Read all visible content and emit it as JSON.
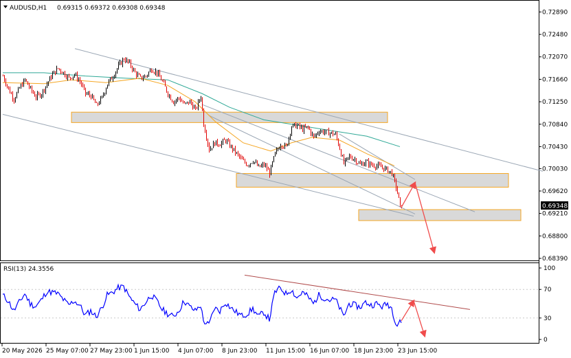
{
  "header": {
    "dropdown_icon": "triangle-down-icon",
    "symbol": "AUDUSD,H1",
    "ohlc": "0.69315 0.69372 0.69308 0.69348"
  },
  "rsi_header": {
    "label": "RSI(13) 24.3556"
  },
  "chart_data": [
    {
      "type": "candlestick",
      "symbol": "AUDUSD",
      "timeframe": "H1",
      "ylim": [
        0.6839,
        0.7292
      ],
      "y_ticks": [
        "0.72890",
        "0.72480",
        "0.72070",
        "0.71660",
        "0.71250",
        "0.70840",
        "0.70430",
        "0.70030",
        "0.69620",
        "0.69210",
        "0.68800",
        "0.68390"
      ],
      "current_price": "0.69348",
      "grid": false,
      "colors": {
        "up": "#000000",
        "down": "#e00000",
        "ma_fast": "#f5a623",
        "ma_slow": "#2ea896",
        "channel": "#9aa6b4",
        "zone": "#d9d9d9",
        "zone_border": "#f5a623",
        "arrow": "#f04c4c"
      },
      "price_path": [
        [
          0,
          0.7172
        ],
        [
          8,
          0.7148
        ],
        [
          16,
          0.713
        ],
        [
          24,
          0.715
        ],
        [
          32,
          0.7165
        ],
        [
          40,
          0.7148
        ],
        [
          48,
          0.7134
        ],
        [
          56,
          0.714
        ],
        [
          64,
          0.7158
        ],
        [
          72,
          0.7175
        ],
        [
          80,
          0.7186
        ],
        [
          88,
          0.7178
        ],
        [
          96,
          0.7168
        ],
        [
          104,
          0.7175
        ],
        [
          112,
          0.7162
        ],
        [
          120,
          0.714
        ],
        [
          128,
          0.7136
        ],
        [
          136,
          0.7118
        ],
        [
          144,
          0.7132
        ],
        [
          152,
          0.7158
        ],
        [
          160,
          0.7172
        ],
        [
          168,
          0.719
        ],
        [
          176,
          0.7204
        ],
        [
          184,
          0.7195
        ],
        [
          192,
          0.7178
        ],
        [
          200,
          0.7168
        ],
        [
          208,
          0.7172
        ],
        [
          216,
          0.7185
        ],
        [
          224,
          0.7178
        ],
        [
          232,
          0.7162
        ],
        [
          240,
          0.714
        ],
        [
          248,
          0.7125
        ],
        [
          256,
          0.7132
        ],
        [
          264,
          0.712
        ],
        [
          272,
          0.7125
        ],
        [
          280,
          0.711
        ],
        [
          288,
          0.7135
        ],
        [
          292,
          0.7085
        ],
        [
          300,
          0.7038
        ],
        [
          308,
          0.705
        ],
        [
          316,
          0.7048
        ],
        [
          324,
          0.7055
        ],
        [
          332,
          0.7042
        ],
        [
          340,
          0.703
        ],
        [
          348,
          0.7018
        ],
        [
          356,
          0.701
        ],
        [
          364,
          0.7018
        ],
        [
          372,
          0.7005
        ],
        [
          380,
          0.701
        ],
        [
          388,
          0.6995
        ],
        [
          396,
          0.703
        ],
        [
          404,
          0.7048
        ],
        [
          412,
          0.7042
        ],
        [
          420,
          0.708
        ],
        [
          428,
          0.7082
        ],
        [
          436,
          0.7075
        ],
        [
          444,
          0.7078
        ],
        [
          452,
          0.706
        ],
        [
          460,
          0.7072
        ],
        [
          468,
          0.707
        ],
        [
          476,
          0.7068
        ],
        [
          484,
          0.7065
        ],
        [
          490,
          0.704
        ],
        [
          496,
          0.7012
        ],
        [
          504,
          0.7025
        ],
        [
          512,
          0.702
        ],
        [
          520,
          0.701
        ],
        [
          528,
          0.7015
        ],
        [
          536,
          0.701
        ],
        [
          544,
          0.7008
        ],
        [
          552,
          0.7005
        ],
        [
          560,
          0.7
        ],
        [
          566,
          0.6995
        ],
        [
          570,
          0.6978
        ],
        [
          574,
          0.696
        ],
        [
          578,
          0.6932
        ],
        [
          580,
          0.6935
        ]
      ],
      "ma_fast": [
        [
          0,
          0.716
        ],
        [
          60,
          0.7158
        ],
        [
          100,
          0.7165
        ],
        [
          150,
          0.716
        ],
        [
          200,
          0.7168
        ],
        [
          240,
          0.7155
        ],
        [
          280,
          0.7125
        ],
        [
          310,
          0.7088
        ],
        [
          350,
          0.705
        ],
        [
          390,
          0.7035
        ],
        [
          420,
          0.705
        ],
        [
          450,
          0.706
        ],
        [
          490,
          0.7055
        ],
        [
          530,
          0.703
        ],
        [
          570,
          0.7008
        ]
      ],
      "ma_slow": [
        [
          0,
          0.7178
        ],
        [
          60,
          0.7178
        ],
        [
          120,
          0.7172
        ],
        [
          180,
          0.7168
        ],
        [
          240,
          0.7165
        ],
        [
          290,
          0.714
        ],
        [
          330,
          0.7115
        ],
        [
          380,
          0.7092
        ],
        [
          430,
          0.7082
        ],
        [
          480,
          0.7072
        ],
        [
          530,
          0.7062
        ],
        [
          578,
          0.7043
        ]
      ],
      "channel_lines": [
        [
          [
            105,
            0.7222
          ],
          [
            786,
            0.6998
          ]
        ],
        [
          [
            0,
            0.7102
          ],
          [
            598,
            0.6916
          ]
        ],
        [
          [
            290,
            0.712
          ],
          [
            687,
            0.6924
          ]
        ],
        [
          [
            300,
            0.71
          ],
          [
            600,
            0.692
          ]
        ],
        [
          [
            490,
            0.7066
          ],
          [
            600,
            0.6983
          ]
        ]
      ],
      "zones": [
        [
          100,
          560,
          0.7106,
          0.7087
        ],
        [
          340,
          736,
          0.6994,
          0.6969
        ],
        [
          518,
          754,
          0.6928,
          0.6908
        ]
      ],
      "arrows": [
        [
          [
            580,
            0.6932
          ],
          [
            600,
            0.6977
          ]
        ],
        [
          [
            600,
            0.6977
          ],
          [
            628,
            0.685
          ]
        ]
      ]
    },
    {
      "type": "line",
      "title": "RSI(13) 24.3556",
      "ylim": [
        0,
        100
      ],
      "y_ticks": [
        "100",
        "70",
        "30",
        "0"
      ],
      "levels": [
        70,
        30
      ],
      "colors": {
        "rsi": "#0000ff",
        "trendline": "#b04a4a",
        "arrow": "#f04c4c"
      },
      "values": [
        [
          0,
          62
        ],
        [
          8,
          54
        ],
        [
          16,
          40
        ],
        [
          24,
          52
        ],
        [
          32,
          64
        ],
        [
          40,
          50
        ],
        [
          48,
          46
        ],
        [
          56,
          55
        ],
        [
          64,
          67
        ],
        [
          72,
          66
        ],
        [
          80,
          64
        ],
        [
          88,
          56
        ],
        [
          96,
          48
        ],
        [
          104,
          54
        ],
        [
          112,
          48
        ],
        [
          120,
          34
        ],
        [
          128,
          40
        ],
        [
          136,
          32
        ],
        [
          144,
          44
        ],
        [
          152,
          62
        ],
        [
          160,
          66
        ],
        [
          168,
          72
        ],
        [
          176,
          74
        ],
        [
          184,
          60
        ],
        [
          192,
          50
        ],
        [
          200,
          42
        ],
        [
          208,
          52
        ],
        [
          216,
          62
        ],
        [
          224,
          54
        ],
        [
          232,
          42
        ],
        [
          240,
          36
        ],
        [
          248,
          32
        ],
        [
          256,
          40
        ],
        [
          264,
          54
        ],
        [
          272,
          46
        ],
        [
          280,
          40
        ],
        [
          288,
          48
        ],
        [
          292,
          26
        ],
        [
          300,
          20
        ],
        [
          308,
          44
        ],
        [
          316,
          40
        ],
        [
          324,
          52
        ],
        [
          332,
          44
        ],
        [
          340,
          38
        ],
        [
          348,
          33
        ],
        [
          356,
          36
        ],
        [
          364,
          43
        ],
        [
          372,
          32
        ],
        [
          380,
          38
        ],
        [
          388,
          28
        ],
        [
          396,
          66
        ],
        [
          404,
          72
        ],
        [
          412,
          64
        ],
        [
          420,
          70
        ],
        [
          428,
          58
        ],
        [
          436,
          66
        ],
        [
          444,
          60
        ],
        [
          452,
          50
        ],
        [
          460,
          62
        ],
        [
          468,
          58
        ],
        [
          476,
          55
        ],
        [
          484,
          56
        ],
        [
          490,
          45
        ],
        [
          496,
          32
        ],
        [
          504,
          50
        ],
        [
          512,
          48
        ],
        [
          520,
          45
        ],
        [
          528,
          52
        ],
        [
          536,
          48
        ],
        [
          544,
          50
        ],
        [
          552,
          46
        ],
        [
          560,
          50
        ],
        [
          566,
          44
        ],
        [
          570,
          30
        ],
        [
          574,
          20
        ],
        [
          578,
          28
        ],
        [
          580,
          24
        ]
      ],
      "trendline": [
        [
          352,
          90
        ],
        [
          680,
          42
        ]
      ],
      "arrows": [
        [
          [
            580,
            26
          ],
          [
            598,
            54
          ]
        ],
        [
          [
            598,
            54
          ],
          [
            614,
            5
          ]
        ]
      ]
    }
  ],
  "x_labels": [
    "20 May 2026",
    "25 May 07:00",
    "27 May 23:00",
    "1 Jun 15:00",
    "4 Jun 07:00",
    "8 Jun 23:00",
    "11 Jun 15:00",
    "16 Jun 07:00",
    "18 Jun 23:00",
    "23 Jun 15:00"
  ]
}
